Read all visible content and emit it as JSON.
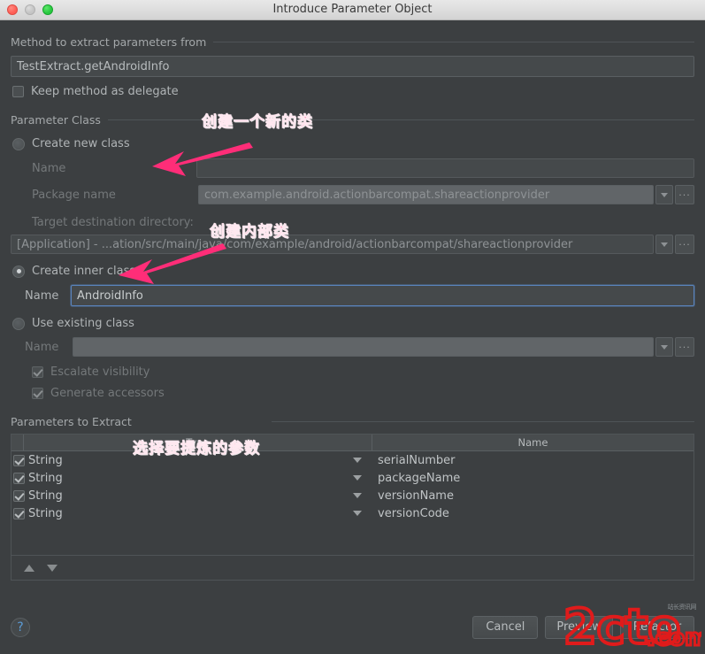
{
  "window": {
    "title": "Introduce Parameter Object",
    "traffic_lights": [
      "close",
      "minimize",
      "zoom"
    ]
  },
  "method_section": {
    "label": "Method to extract parameters from",
    "method_value": "TestExtract.getAndroidInfo",
    "keep_delegate_label": "Keep method as delegate",
    "keep_delegate_checked": false
  },
  "parameter_class_section": {
    "label": "Parameter Class",
    "create_new_class": {
      "label": "Create new class",
      "selected": false,
      "name_label": "Name",
      "name_value": "",
      "package_label": "Package name",
      "package_value": "com.example.android.actionbarcompat.shareactionprovider",
      "target_dir_label": "Target destination directory:",
      "target_dir_value": "[Application] - ...ation/src/main/java/com/example/android/actionbarcompat/shareactionprovider"
    },
    "create_inner_class": {
      "label": "Create inner class",
      "selected": true,
      "name_label": "Name",
      "name_value": "AndroidInfo"
    },
    "use_existing_class": {
      "label": "Use existing class",
      "selected": false,
      "name_label": "Name",
      "name_value": "",
      "escalate_visibility_label": "Escalate visibility",
      "escalate_visibility_checked": true,
      "generate_accessors_label": "Generate accessors",
      "generate_accessors_checked": true
    }
  },
  "parameters_section": {
    "label": "Parameters to Extract",
    "columns": [
      "Type",
      "Name"
    ],
    "rows": [
      {
        "checked": true,
        "type": "String",
        "name": "serialNumber"
      },
      {
        "checked": true,
        "type": "String",
        "name": "packageName"
      },
      {
        "checked": true,
        "type": "String",
        "name": "versionName"
      },
      {
        "checked": true,
        "type": "String",
        "name": "versionCode"
      }
    ],
    "move_up_icon": "arrow-up-icon",
    "move_down_icon": "arrow-down-icon"
  },
  "footer": {
    "help_label": "?",
    "cancel_label": "Cancel",
    "preview_label": "Preview",
    "refactor_label": "Refactor"
  },
  "annotations": [
    {
      "text": "创建一个新的类",
      "target": "create-new-class-radio"
    },
    {
      "text": "创建内部类",
      "target": "create-inner-class-radio"
    },
    {
      "text": "选择要提炼的参数",
      "target": "parameters-to-extract-section"
    }
  ],
  "watermark": {
    "text": "2cto.com",
    "sub_text": "站长资讯网"
  },
  "colors": {
    "dialog_bg": "#3c3f41",
    "accent_focus": "#5a84bd",
    "annotation": "#ff2d78",
    "watermark": "#e01b1b",
    "help_icon": "#5b9bd5"
  }
}
